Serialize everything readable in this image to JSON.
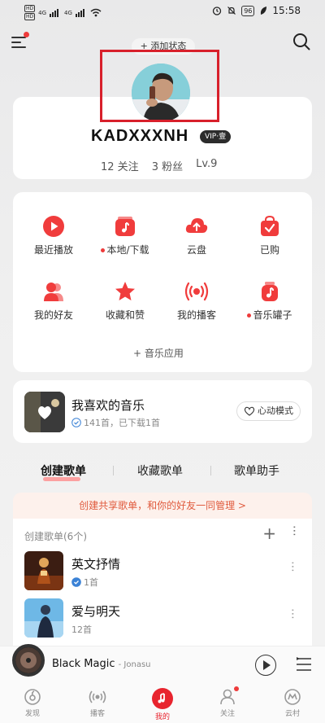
{
  "status_bar": {
    "hd1": "HD",
    "hd2": "HD",
    "net1": "4G",
    "net2": "4G",
    "battery": "96",
    "time": "15:58"
  },
  "top": {
    "add_status": "+ 添加状态"
  },
  "profile": {
    "username": "KADXXXNH",
    "vip_label": "VIP·壹",
    "following": "12 关注",
    "followers": "3 粉丝",
    "level": "Lv.9"
  },
  "grid": {
    "items": [
      {
        "label": "最近播放",
        "icon": "play-circle-icon",
        "dot": false
      },
      {
        "label": "本地/下载",
        "icon": "music-album-icon",
        "dot": true
      },
      {
        "label": "云盘",
        "icon": "cloud-upload-icon",
        "dot": false
      },
      {
        "label": "已购",
        "icon": "shopping-bag-icon",
        "dot": false
      },
      {
        "label": "我的好友",
        "icon": "friends-icon",
        "dot": false
      },
      {
        "label": "收藏和赞",
        "icon": "star-icon",
        "dot": false
      },
      {
        "label": "我的播客",
        "icon": "podcast-icon",
        "dot": false
      },
      {
        "label": "音乐罐子",
        "icon": "music-jar-icon",
        "dot": true
      }
    ],
    "music_app": "+ 音乐应用"
  },
  "liked": {
    "title": "我喜欢的音乐",
    "subtitle": "141首，已下载1首",
    "heart_mode": "心动模式"
  },
  "tabs": {
    "items": [
      "创建歌单",
      "收藏歌单",
      "歌单助手"
    ],
    "active": 0
  },
  "share_banner": "创建共享歌单，和你的好友一同管理 >",
  "playlists": {
    "header": "创建歌单(6个)",
    "rows": [
      {
        "name": "英文抒情",
        "count": "1首",
        "downloaded": true
      },
      {
        "name": "爱与明天",
        "count": "12首",
        "downloaded": false
      }
    ]
  },
  "player": {
    "song": "Black Magic",
    "artist": "- Jonasu"
  },
  "nav": {
    "items": [
      "发现",
      "播客",
      "我的",
      "关注",
      "云村"
    ],
    "active": 2
  },
  "colors": {
    "brand_red": "#e8242e",
    "highlight_box": "#d8202b",
    "banner_text": "#e05a3d"
  }
}
